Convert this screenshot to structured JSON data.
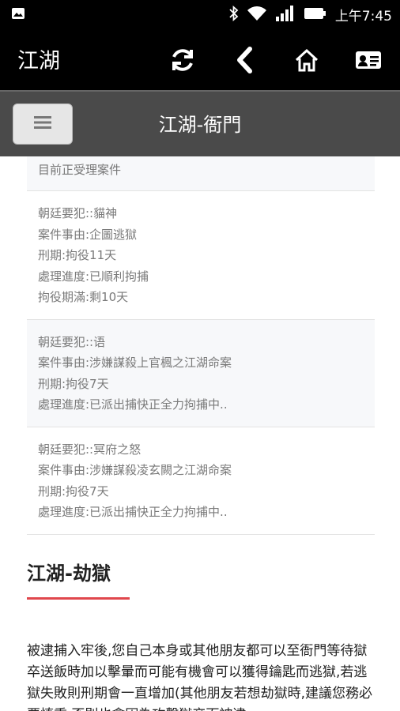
{
  "statusbar": {
    "time": "上午7:45",
    "icons": [
      "image-icon",
      "bluetooth-icon",
      "wifi-icon",
      "signal-icon",
      "battery-icon"
    ]
  },
  "appbar": {
    "title": "江湖",
    "icons": [
      "refresh-icon",
      "back-icon",
      "home-icon",
      "id-card-icon"
    ]
  },
  "subbar": {
    "title": "江湖-衙門",
    "menu_icon": "menu-icon"
  },
  "case_list": {
    "header": "目前正受理案件",
    "cases": [
      {
        "lines": [
          "朝廷要犯::貓神",
          "案件事由:企圖逃獄",
          "刑期:拘役11天",
          "處理進度:已順利拘捕",
          "拘役期滿:剩10天"
        ]
      },
      {
        "lines": [
          "朝廷要犯::语",
          "案件事由:涉嫌謀殺上官楓之江湖命案",
          "刑期:拘役7天",
          "處理進度:已派出捕快正全力拘捕中.."
        ]
      },
      {
        "lines": [
          "朝廷要犯::冥府之怒",
          "案件事由:涉嫌謀殺凌玄闕之江湖命案",
          "刑期:拘役7天",
          "處理進度:已派出捕快正全力拘捕中.."
        ]
      }
    ]
  },
  "section": {
    "title": "江湖-劫獄",
    "accent_color": "#e0474c",
    "body": "被逮捕入牢後,您自己本身或其他朋友都可以至衙門等待獄卒送飯時加以擊暈而可能有機會可以獲得鑰匙而逃獄,若逃獄失敗則刑期會一直增加(其他朋友若想劫獄時,建議您務必要慎重,否則也會因為攻擊獄卒而被逮"
  }
}
